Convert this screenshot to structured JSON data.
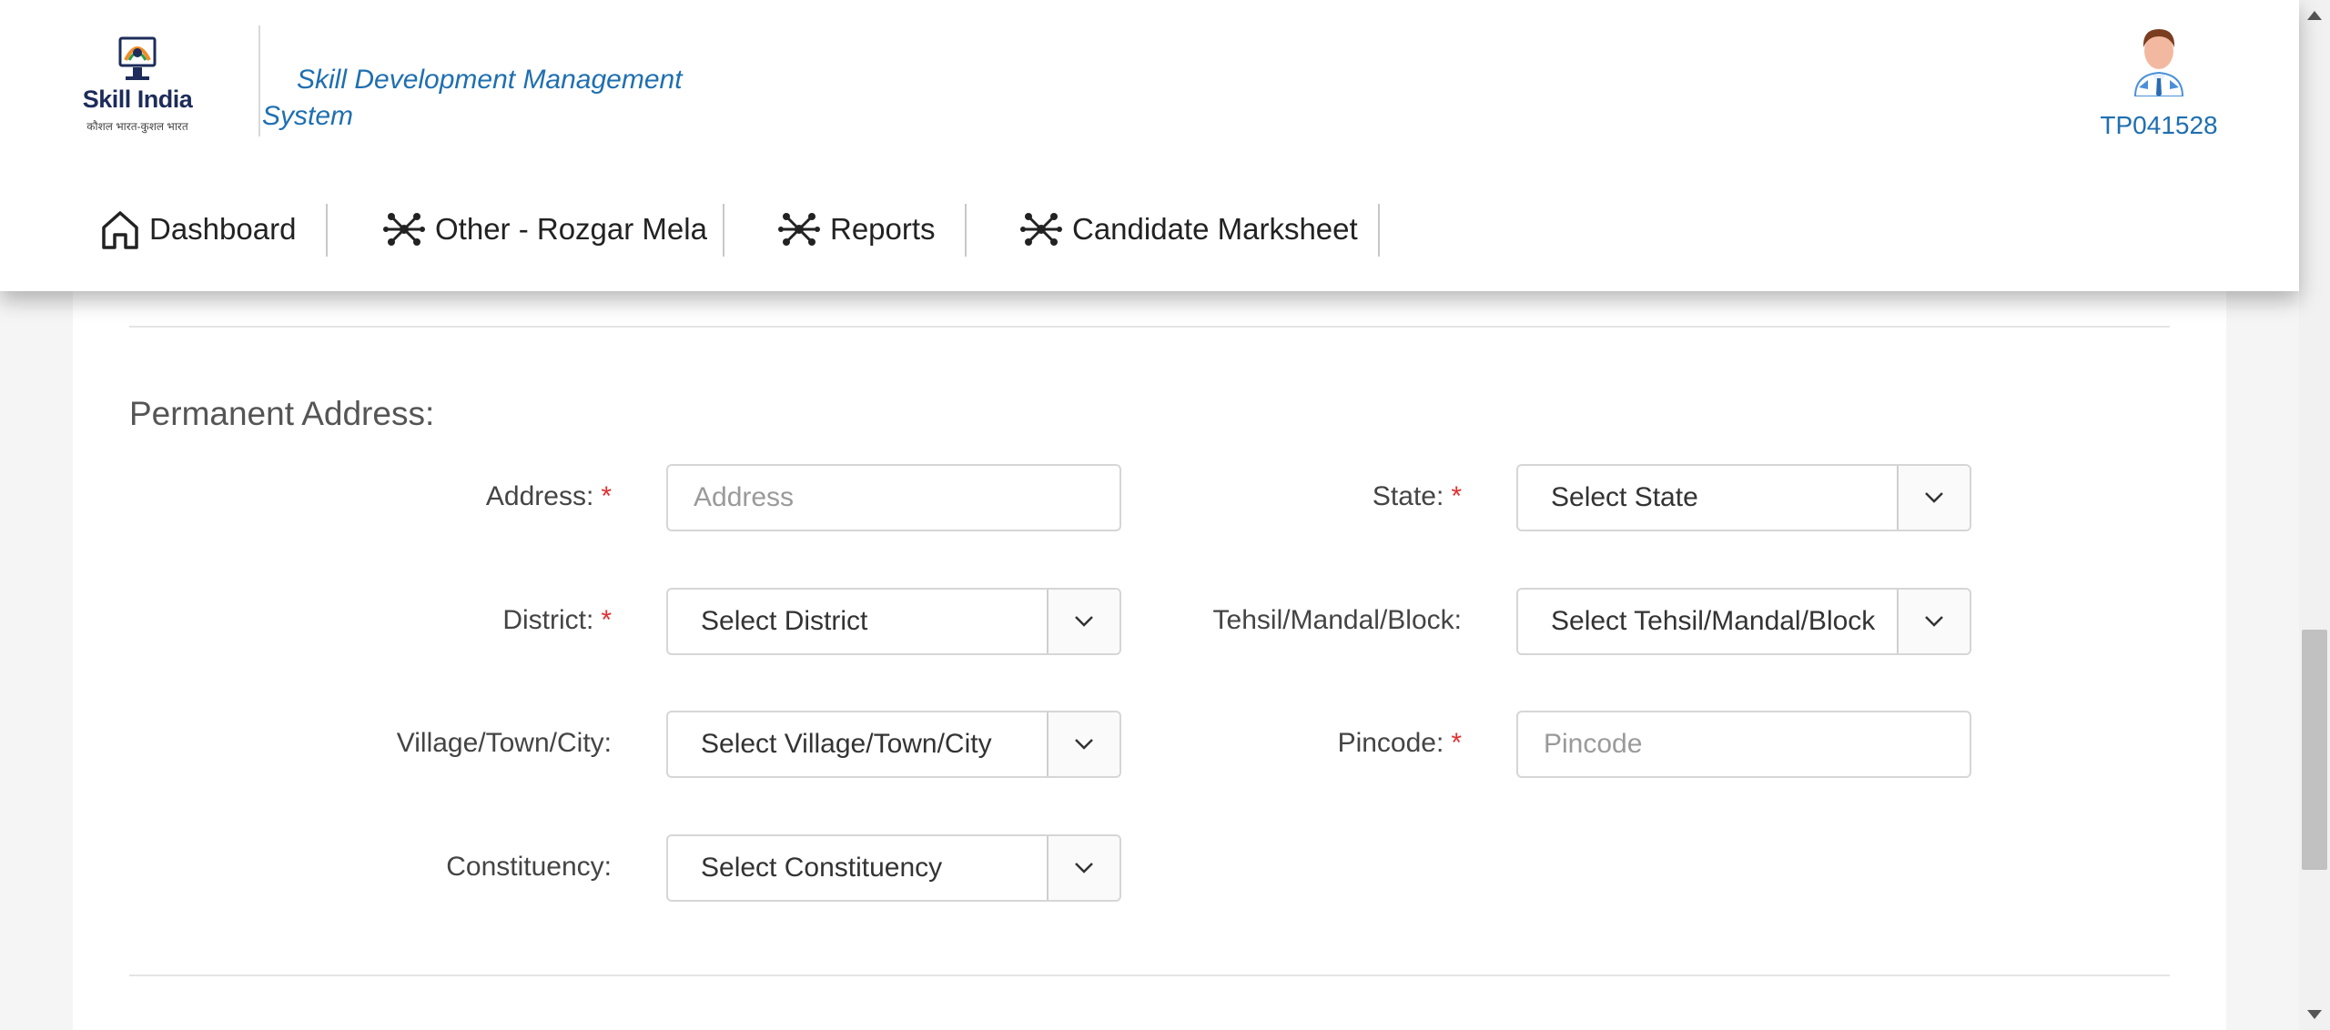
{
  "header": {
    "logo": {
      "brand": "Skill India",
      "tagline": "कौशल भारत-कुशल भारत"
    },
    "app_title": "Skill Development Management System",
    "user_id": "TP041528"
  },
  "nav": {
    "items": [
      {
        "label": "Dashboard",
        "icon": "home-icon"
      },
      {
        "label": "Other - Rozgar Mela",
        "icon": "network-icon"
      },
      {
        "label": "Reports",
        "icon": "network-icon"
      },
      {
        "label": "Candidate Marksheet",
        "icon": "network-icon"
      }
    ]
  },
  "form": {
    "section_title": "Permanent Address:",
    "required_mark": "*",
    "address": {
      "label": "Address:",
      "placeholder": "Address"
    },
    "state": {
      "label": "State:",
      "value": "Select State"
    },
    "district": {
      "label": "District:",
      "value": "Select District"
    },
    "tehsil": {
      "label": "Tehsil/Mandal/Block:",
      "value": "Select Tehsil/Mandal/Block"
    },
    "village": {
      "label": "Village/Town/City:",
      "value": "Select Village/Town/City"
    },
    "pincode": {
      "label": "Pincode:",
      "placeholder": "Pincode"
    },
    "constituency": {
      "label": "Constituency:",
      "value": "Select Constituency"
    }
  },
  "colors": {
    "accent": "#1f6fb0",
    "required": "#e03131"
  }
}
